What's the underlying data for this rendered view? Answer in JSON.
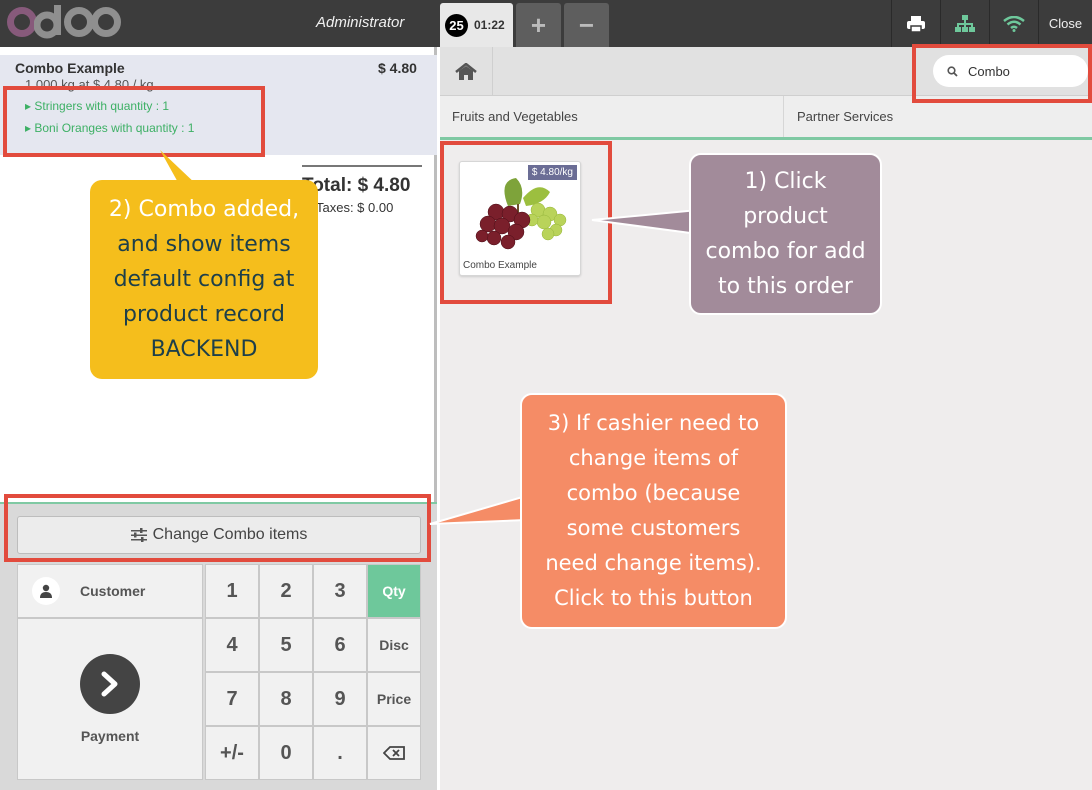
{
  "header": {
    "user": "Administrator",
    "order_number": "25",
    "order_time": "01:22",
    "add_order": "+",
    "remove_order": "−",
    "close": "Close"
  },
  "order": {
    "line_name": "Combo Example",
    "line_price": "$ 4.80",
    "line_info": "1.000 kg at $ 4.80 / kg",
    "combo_items": [
      "Stringers with quantity : 1",
      "Boni Oranges with quantity : 1"
    ],
    "total": "Total: $ 4.80",
    "taxes": "Taxes: $ 0.00"
  },
  "actions": {
    "change_combo": "Change Combo items",
    "customer": "Customer",
    "payment": "Payment"
  },
  "numpad": {
    "keys": [
      "1",
      "2",
      "3",
      "4",
      "5",
      "6",
      "7",
      "8",
      "9",
      "+/-",
      "0",
      "."
    ],
    "modes": [
      "Qty",
      "Disc",
      "Price"
    ]
  },
  "products": {
    "search_value": "Combo",
    "categories": [
      "Fruits and Vegetables",
      "Partner Services"
    ],
    "items": [
      {
        "name": "Combo Example",
        "price": "$ 4.80/kg"
      }
    ]
  },
  "annotations": {
    "a1": [
      "1) Click",
      "product",
      "combo for add",
      "to this order"
    ],
    "a2_pre": "2) Combo added,",
    "a2_mid1": "and ",
    "a2_mid2": "show items",
    "a2_rest": [
      "default config at",
      "product record",
      "BACKEND"
    ],
    "a3": [
      "3) If cashier need to",
      "change items of",
      "combo (because",
      "some customers",
      "need change items).",
      "Click to this button"
    ]
  },
  "colors": {
    "topbar": "#3c3c3c",
    "accent_green": "#6ec89b",
    "logo_purple": "#875a7b",
    "logo_gray": "#8f8f8f",
    "annotation_red": "#e24b3d",
    "callout_purple": "#a28b9a",
    "callout_yellow": "#f5be1c",
    "callout_orange": "#f58c66"
  }
}
